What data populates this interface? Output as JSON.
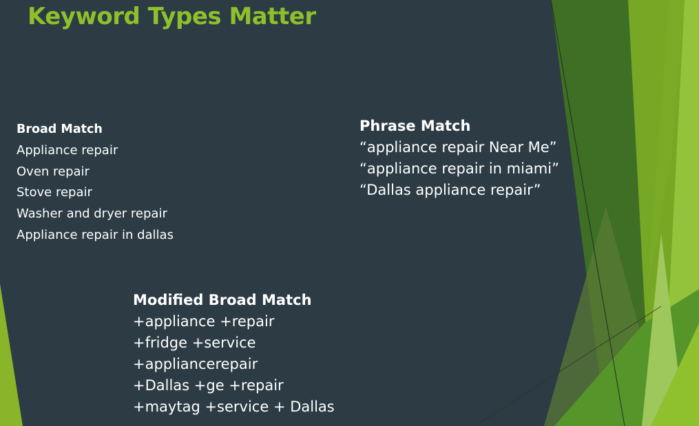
{
  "slide": {
    "title": "Keyword Types Matter",
    "colors": {
      "background": "#2c3b44",
      "title": "#8dc02b",
      "text": "#ffffff",
      "green_dark": "#3f6f25",
      "green_mid": "#77a825",
      "green_light": "#93c33a",
      "green_pale": "#a2c95f",
      "green_accent": "#8ab52a"
    },
    "broad_match": {
      "heading": "Broad Match",
      "items": [
        "Appliance repair",
        "Oven repair",
        "Stove repair",
        "Washer and dryer repair",
        "Appliance repair in dallas"
      ]
    },
    "phrase_match": {
      "heading": "Phrase Match",
      "items": [
        "“appliance repair Near Me”",
        "“appliance repair in miami”",
        "“Dallas appliance repair”"
      ]
    },
    "modified_broad_match": {
      "heading": "Modified Broad Match",
      "items": [
        "+appliance +repair",
        "+fridge +service",
        "+appliancerepair",
        "+Dallas +ge +repair",
        "+maytag +service + Dallas"
      ]
    }
  }
}
